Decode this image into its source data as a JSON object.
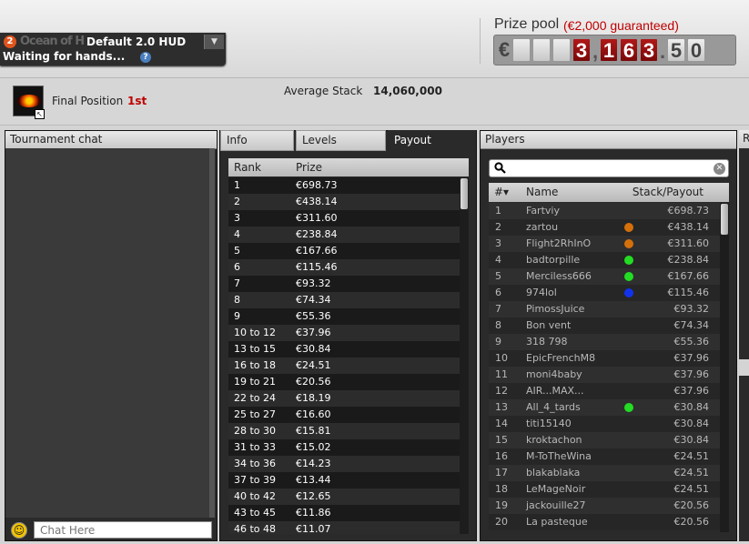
{
  "hud": {
    "badge": "2",
    "watermark": "Ocean of Hold'em",
    "name": "Default 2.0 HUD",
    "dropdown_icon": "chevron-down-icon",
    "status": "Waiting for hands...",
    "help": "?"
  },
  "prize_pool": {
    "label": "Prize pool",
    "guarantee": "(€2,000 guaranteed)",
    "currency": "€",
    "digits": [
      "",
      "",
      "",
      "3",
      ",",
      "1",
      "6",
      "3",
      ".",
      "5",
      "0"
    ],
    "value": "€3,163.50"
  },
  "summary": {
    "final_position_label": "Final Position",
    "final_position_value": "1st",
    "average_stack_label": "Average Stack",
    "average_stack_value": "14,060,000"
  },
  "chat": {
    "title": "Tournament chat",
    "input_placeholder": "Chat Here",
    "smiley_icon": "smiley-icon"
  },
  "tabs": [
    {
      "label": "Info",
      "active": false
    },
    {
      "label": "Levels",
      "active": false
    },
    {
      "label": "Payout",
      "active": true
    }
  ],
  "payout": {
    "headers": [
      "Rank",
      "Prize"
    ],
    "rows": [
      [
        "1",
        "€698.73"
      ],
      [
        "2",
        "€438.14"
      ],
      [
        "3",
        "€311.60"
      ],
      [
        "4",
        "€238.84"
      ],
      [
        "5",
        "€167.66"
      ],
      [
        "6",
        "€115.46"
      ],
      [
        "7",
        "€93.32"
      ],
      [
        "8",
        "€74.34"
      ],
      [
        "9",
        "€55.36"
      ],
      [
        "10 to 12",
        "€37.96"
      ],
      [
        "13 to 15",
        "€30.84"
      ],
      [
        "16 to 18",
        "€24.51"
      ],
      [
        "19 to 21",
        "€20.56"
      ],
      [
        "22 to 24",
        "€18.19"
      ],
      [
        "25 to 27",
        "€16.60"
      ],
      [
        "28 to 30",
        "€15.81"
      ],
      [
        "31 to 33",
        "€15.02"
      ],
      [
        "34 to 36",
        "€14.23"
      ],
      [
        "37 to 39",
        "€13.44"
      ],
      [
        "40 to 42",
        "€12.65"
      ],
      [
        "43 to 45",
        "€11.86"
      ],
      [
        "46 to 48",
        "€11.07"
      ]
    ]
  },
  "players": {
    "title": "Players",
    "search_icon": "search-icon",
    "clear_icon": "clear-icon",
    "headers": [
      "#▾",
      "Name",
      "Stack/Payout"
    ],
    "rows": [
      {
        "n": "1",
        "name": "Fartviy",
        "dot": "",
        "stack": "€698.73"
      },
      {
        "n": "2",
        "name": "zartou",
        "dot": "#d4700a",
        "stack": "€438.14"
      },
      {
        "n": "3",
        "name": "Flight2RhInO",
        "dot": "#d4700a",
        "stack": "€311.60"
      },
      {
        "n": "4",
        "name": "badtorpille",
        "dot": "#22dd22",
        "stack": "€238.84"
      },
      {
        "n": "5",
        "name": "Merciless666",
        "dot": "#22dd22",
        "stack": "€167.66"
      },
      {
        "n": "6",
        "name": "974lol",
        "dot": "#1133ee",
        "stack": "€115.46"
      },
      {
        "n": "7",
        "name": "PimossJuice",
        "dot": "",
        "stack": "€93.32"
      },
      {
        "n": "8",
        "name": "Bon vent",
        "dot": "",
        "stack": "€74.34"
      },
      {
        "n": "9",
        "name": "318 798",
        "dot": "",
        "stack": "€55.36"
      },
      {
        "n": "10",
        "name": "EpicFrenchM8",
        "dot": "",
        "stack": "€37.96"
      },
      {
        "n": "11",
        "name": "moni4baby",
        "dot": "",
        "stack": "€37.96"
      },
      {
        "n": "12",
        "name": "AIR...MAX...",
        "dot": "",
        "stack": "€37.96"
      },
      {
        "n": "13",
        "name": "All_4_tards",
        "dot": "#22dd22",
        "stack": "€30.84"
      },
      {
        "n": "14",
        "name": "titi15140",
        "dot": "",
        "stack": "€30.84"
      },
      {
        "n": "15",
        "name": "kroktachon",
        "dot": "",
        "stack": "€30.84"
      },
      {
        "n": "16",
        "name": "M-ToTheWina",
        "dot": "",
        "stack": "€24.51"
      },
      {
        "n": "17",
        "name": "blakablaka",
        "dot": "",
        "stack": "€24.51"
      },
      {
        "n": "18",
        "name": "LeMageNoir",
        "dot": "",
        "stack": "€24.51"
      },
      {
        "n": "19",
        "name": "jackouille27",
        "dot": "",
        "stack": "€20.56"
      },
      {
        "n": "20",
        "name": "La pasteque",
        "dot": "",
        "stack": "€20.56"
      }
    ]
  },
  "right_panel": {
    "title": "R"
  },
  "colors": {
    "accent_red": "#c00000",
    "panel_dark": "#2a2a2a"
  }
}
